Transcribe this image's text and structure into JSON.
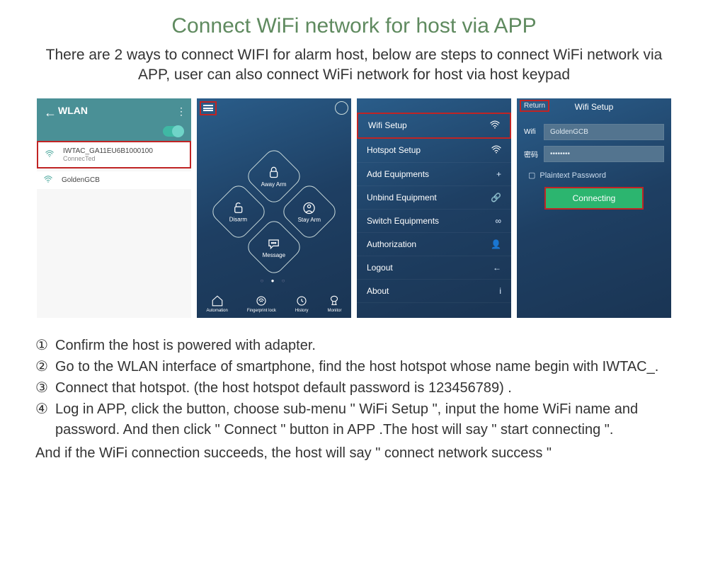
{
  "title": "Connect WiFi network for host via APP",
  "subtitle": "There are 2 ways to connect WIFI for alarm host, below are steps to connect WiFi network via APP, user can also connect WiFi network for host via host keypad",
  "phone1": {
    "header": "WLAN",
    "net1_name": "IWTAC_GA11EU6B1000100",
    "net1_status": "ConnecTed",
    "net2_name": "GoldenGCB"
  },
  "phone2": {
    "diamond": {
      "top": "Away Arm",
      "left": "Disarm",
      "right": "Stay Arm",
      "bottom": "Message"
    },
    "bottom": {
      "a": "Automation",
      "b": "Fingerprint lock",
      "c": "History",
      "d": "Monitor"
    }
  },
  "phone3": {
    "items": [
      {
        "label": "Wifi Setup",
        "icon": "wifi"
      },
      {
        "label": "Hotspot Setup",
        "icon": "wifi"
      },
      {
        "label": "Add Equipments",
        "icon": "plus"
      },
      {
        "label": "Unbind Equipment",
        "icon": "link"
      },
      {
        "label": "Switch Equipments",
        "icon": "infinity"
      },
      {
        "label": "Authorization",
        "icon": "user"
      },
      {
        "label": "Logout",
        "icon": "back"
      },
      {
        "label": "About",
        "icon": "info"
      }
    ]
  },
  "phone4": {
    "return": "Return",
    "title": "Wifi Setup",
    "wifi_label": "Wifi",
    "wifi_value": "GoldenGCB",
    "pwd_label": "密码",
    "pwd_value": "••••••••",
    "plaintext": "Plaintext Password",
    "button": "Connecting"
  },
  "instructions": {
    "n1": "①",
    "t1": "Confirm the host is powered with adapter.",
    "n2": "②",
    "t2": "Go to the WLAN interface of smartphone, find the host hotspot whose name begin with IWTAC_.",
    "n3": "③",
    "t3": "Connect that hotspot. (the host hotspot default password is 123456789) .",
    "n4": "④",
    "t4": "Log in APP, click the      button, choose sub-menu \" WiFi Setup \", input the home WiFi name and password. And then click \" Connect \" button in APP .The host will say \"  start connecting \".",
    "note": "And if the WiFi connection succeeds, the host will say \" connect network success \""
  }
}
